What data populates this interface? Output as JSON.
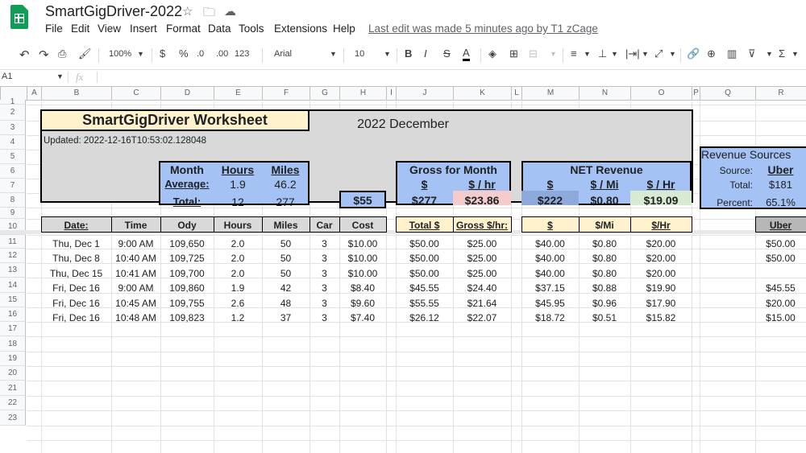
{
  "app": {
    "title": "SmartGigDriver-2022",
    "menus": [
      "File",
      "Edit",
      "View",
      "Insert",
      "Format",
      "Data",
      "Tools",
      "Extensions",
      "Help"
    ],
    "last_edit": "Last edit was made 5 minutes ago by T1 zCage"
  },
  "toolbar": {
    "zoom": "100%",
    "currency": "$",
    "percent": "%",
    "dec_less": ".0",
    "dec_more": ".00",
    "format": "123",
    "font": "Arial",
    "size": "10",
    "bold": "B",
    "italic": "I",
    "strike": "S",
    "textcolor": "A"
  },
  "formula": {
    "cellref": "A1",
    "fx": "fx"
  },
  "columns": [
    "A",
    "B",
    "C",
    "D",
    "E",
    "F",
    "G",
    "H",
    "I",
    "J",
    "K",
    "L",
    "M",
    "N",
    "O",
    "P",
    "Q",
    "R"
  ],
  "rows": [
    "1",
    "2",
    "3",
    "4",
    "5",
    "6",
    "7",
    "8",
    "9",
    "10",
    "11",
    "12",
    "13",
    "14",
    "15",
    "16",
    "17",
    "18",
    "19",
    "20",
    "21",
    "22",
    "23"
  ],
  "sheet": {
    "worksheet_title": "SmartGigDriver Worksheet",
    "month_label": "2022  December",
    "updated": "Updated: 2022-12-16T10:53:02.128048",
    "summary": {
      "month": "Month",
      "hours": "Hours",
      "miles": "Miles",
      "average": "Average:",
      "avg_hours": "1.9",
      "avg_miles": "46.2",
      "total": "Total:",
      "tot_hours": "12",
      "tot_miles": "277",
      "cost_total": "$55"
    },
    "gross": {
      "title": "Gross for Month",
      "dollar": "$",
      "per_hr": "$ / hr",
      "total": "$277",
      "rate": "$23.86"
    },
    "net": {
      "title": "NET Revenue",
      "dollar": "$",
      "per_mi": "$ / Mi",
      "per_hr": "$ / Hr",
      "total": "$222",
      "mi": "$0.80",
      "hr": "$19.09"
    },
    "revenue": {
      "title": "Revenue Sources",
      "source_label": "Source:",
      "source": "Uber",
      "total_label": "Total:",
      "total": "$181",
      "percent_label": "Percent:",
      "percent": "65.1%"
    },
    "headers": [
      "Date:",
      "Time",
      "Ody",
      "Hours",
      "Miles",
      "Car",
      "Cost",
      "Total $",
      "Gross $/hr:",
      "$",
      "$/Mi",
      "$/Hr",
      "Uber"
    ],
    "entries": [
      [
        "Thu, Dec 1",
        "9:00 AM",
        "109,650",
        "2.0",
        "50",
        "3",
        "$10.00",
        "$50.00",
        "$25.00",
        "$40.00",
        "$0.80",
        "$20.00",
        "$50.00"
      ],
      [
        "Thu, Dec 8",
        "10:40 AM",
        "109,725",
        "2.0",
        "50",
        "3",
        "$10.00",
        "$50.00",
        "$25.00",
        "$40.00",
        "$0.80",
        "$20.00",
        "$50.00"
      ],
      [
        "Thu, Dec 15",
        "10:41 AM",
        "109,700",
        "2.0",
        "50",
        "3",
        "$10.00",
        "$50.00",
        "$25.00",
        "$40.00",
        "$0.80",
        "$20.00",
        ""
      ],
      [
        "Fri, Dec 16",
        "9:00 AM",
        "109,860",
        "1.9",
        "42",
        "3",
        "$8.40",
        "$45.55",
        "$24.40",
        "$37.15",
        "$0.88",
        "$19.90",
        "$45.55"
      ],
      [
        "Fri, Dec 16",
        "10:45 AM",
        "109,755",
        "2.6",
        "48",
        "3",
        "$9.60",
        "$55.55",
        "$21.64",
        "$45.95",
        "$0.96",
        "$17.90",
        "$20.00"
      ],
      [
        "Fri, Dec 16",
        "10:48 AM",
        "109,823",
        "1.2",
        "37",
        "3",
        "$7.40",
        "$26.12",
        "$22.07",
        "$18.72",
        "$0.51",
        "$15.82",
        "$15.00"
      ]
    ]
  }
}
